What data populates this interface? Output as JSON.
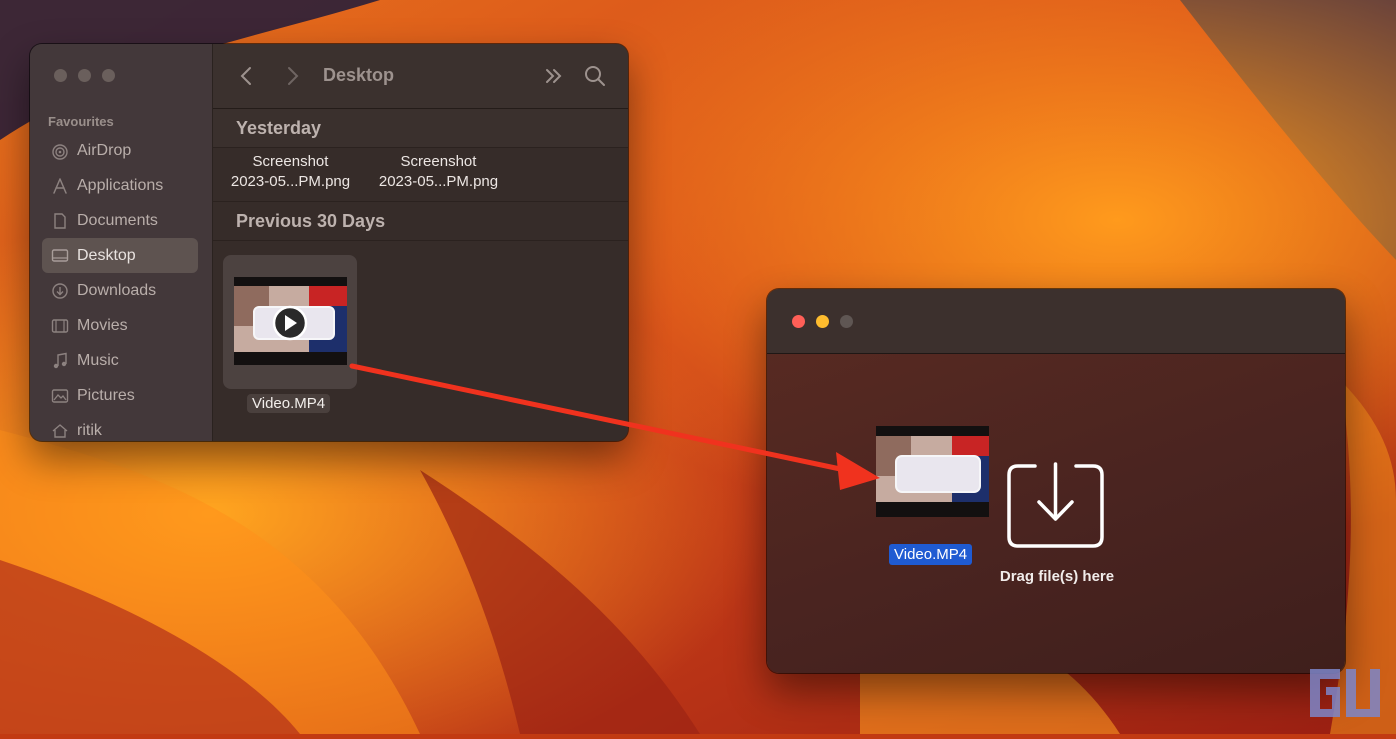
{
  "finder": {
    "title": "Desktop",
    "sidebar": {
      "section": "Favourites",
      "items": [
        {
          "label": "AirDrop",
          "icon": "airdrop-icon"
        },
        {
          "label": "Applications",
          "icon": "applications-icon"
        },
        {
          "label": "Documents",
          "icon": "document-icon"
        },
        {
          "label": "Desktop",
          "icon": "desktop-icon",
          "active": true
        },
        {
          "label": "Downloads",
          "icon": "download-icon"
        },
        {
          "label": "Movies",
          "icon": "film-icon"
        },
        {
          "label": "Music",
          "icon": "music-note-icon"
        },
        {
          "label": "Pictures",
          "icon": "photo-icon"
        },
        {
          "label": "ritik",
          "icon": "home-icon"
        }
      ]
    },
    "groups": {
      "yesterday": "Yesterday",
      "previous": "Previous 30 Days"
    },
    "files": {
      "screenshot1": {
        "line1": "Screenshot",
        "line2": "2023-05...PM.png"
      },
      "screenshot2": {
        "line1": "Screenshot",
        "line2": "2023-05...PM.png"
      },
      "video": "Video.MP4"
    }
  },
  "drop_window": {
    "dragged_file": "Video.MP4",
    "prompt": "Drag file(s) here"
  },
  "colors": {
    "selection": "#1f5bd2",
    "arrow": "#f0321e",
    "close": "#ff5f57",
    "minimize": "#febc2e"
  }
}
